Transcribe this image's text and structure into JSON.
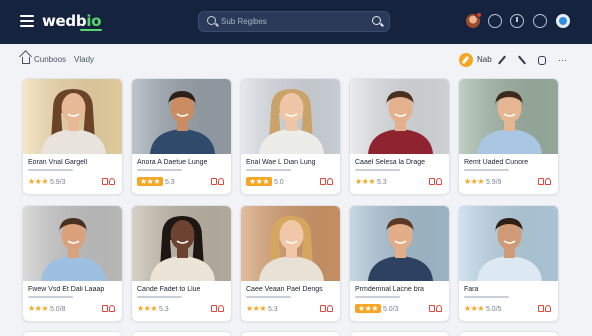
{
  "header": {
    "logo_main": "wedb",
    "logo_accent": "io",
    "search_placeholder": "Sub Regibes"
  },
  "breadcrumb": {
    "items": [
      "Cunboos",
      "Vlady"
    ]
  },
  "actions": {
    "label": "Nab"
  },
  "colors": {
    "topbar": "#15233f",
    "accent": "#f5a623",
    "brand_green": "#5bd66a",
    "icon_red": "#e0483c"
  },
  "cards": [
    {
      "name": "Eoran Vnal Gargell",
      "rating_text": "5.9/3",
      "badge": false,
      "bg": "#f2d9a8",
      "skin": "#e8b996",
      "hair": "#6b4428",
      "shirt": "#e8e3dc",
      "hair_long": true
    },
    {
      "name": "Anora A Daetue Lunge",
      "rating_text": "5.3",
      "badge": true,
      "bg": "#9aa4ae",
      "skin": "#c98c63",
      "hair": "#2b1f18",
      "shirt": "#2f4a6a",
      "hair_long": false
    },
    {
      "name": "Enal Wae L Dian Lung",
      "rating_text": "5.0",
      "badge": true,
      "bg": "#d8dde3",
      "skin": "#f0c7a6",
      "hair": "#c9a36a",
      "shirt": "#ecece8",
      "hair_long": true
    },
    {
      "name": "Caael Selesa la Drage",
      "rating_text": "5.3",
      "badge": false,
      "bg": "#dfe2e5",
      "skin": "#e5b08c",
      "hair": "#4a3020",
      "shirt": "#8e2430",
      "hair_long": false
    },
    {
      "name": "Remt Uaded Cunore",
      "rating_text": "5.9/9",
      "badge": false,
      "bg": "#9fb4a4",
      "skin": "#e6b592",
      "hair": "#3c2a1d",
      "shirt": "#a9c7e3",
      "hair_long": false
    },
    {
      "name": "Fwew Vsd Et Dali Laaap",
      "rating_text": "5.0/8",
      "badge": false,
      "bg": "#c7c7c7",
      "skin": "#d9a27c",
      "hair": "#4a3020",
      "shirt": "#9dc0e0",
      "hair_long": false
    },
    {
      "name": "Cande Fadet to Llue",
      "rating_text": "5.3",
      "badge": false,
      "bg": "#c0b8a8",
      "skin": "#6b4330",
      "hair": "#1e1612",
      "shirt": "#ece4d6",
      "hair_long": true
    },
    {
      "name": "Caee Veaan Pael Dengs",
      "rating_text": "5.3",
      "badge": false,
      "bg": "#d49a6a",
      "skin": "#f0c8a8",
      "hair": "#d4a660",
      "shirt": "#e8e1d5",
      "hair_long": true
    },
    {
      "name": "Prmdemnal Lacne bra",
      "rating_text": "5.0/3",
      "badge": true,
      "bg": "#a8c2d4",
      "skin": "#e3ad88",
      "hair": "#5a3a22",
      "shirt": "#2f4160",
      "hair_long": false
    },
    {
      "name": "Fara",
      "rating_text": "5.0/5",
      "badge": false,
      "bg": "#b8d4e6",
      "skin": "#cf9a75",
      "hair": "#2e2016",
      "shirt": "#dce8f2",
      "hair_long": false
    }
  ]
}
